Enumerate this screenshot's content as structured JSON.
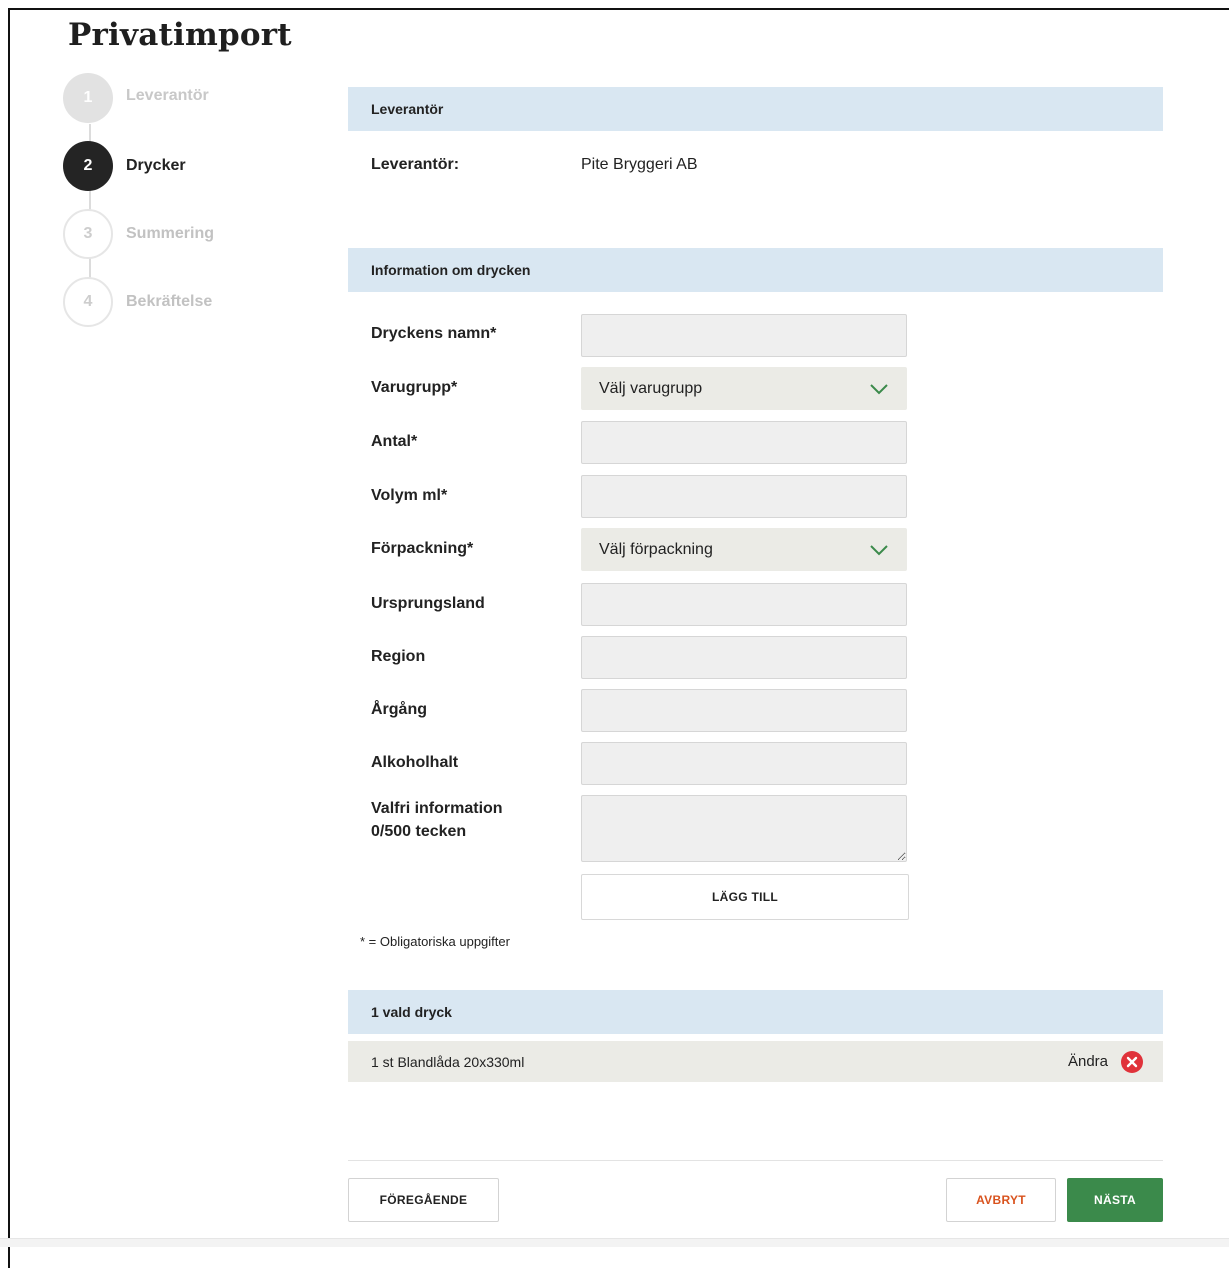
{
  "page": {
    "title": "Privatimport"
  },
  "steps": [
    {
      "number": "1",
      "label": "Leverantör",
      "state": "done"
    },
    {
      "number": "2",
      "label": "Drycker",
      "state": "active"
    },
    {
      "number": "3",
      "label": "Summering",
      "state": "future"
    },
    {
      "number": "4",
      "label": "Bekräftelse",
      "state": "future"
    }
  ],
  "supplier": {
    "header": "Leverantör",
    "label": "Leverantör:",
    "value": "Pite Bryggeri AB"
  },
  "drink_info": {
    "header": "Information om drycken",
    "name_label": "Dryckens namn*",
    "name_value": "",
    "category_label": "Varugrupp*",
    "category_selected": "Välj varugrupp",
    "quantity_label": "Antal*",
    "quantity_value": "",
    "volume_label": "Volym ml*",
    "volume_value": "",
    "packaging_label": "Förpackning*",
    "packaging_selected": "Välj förpackning",
    "origin_label": "Ursprungsland",
    "origin_value": "",
    "region_label": "Region",
    "region_value": "",
    "vintage_label": "Årgång",
    "vintage_value": "",
    "abv_label": "Alkoholhalt",
    "abv_value": "",
    "extra_label_line1": "Valfri information",
    "extra_label_line2": "0/500 tecken",
    "extra_value": "",
    "add_button": "LÄGG TILL",
    "required_note": "* = Obligatoriska uppgifter"
  },
  "selected": {
    "header": "1 vald dryck",
    "items": [
      {
        "text": "1 st Blandlåda 20x330ml",
        "edit_label": "Ändra"
      }
    ]
  },
  "footer": {
    "prev_button": "FÖREGÅENDE",
    "cancel_button": "AVBRYT",
    "next_button": "NÄSTA"
  },
  "colors": {
    "section_header_bg": "#d9e7f2",
    "next_button_bg": "#3b8a4b",
    "cancel_text": "#d9531e",
    "remove_icon": "#e0323a",
    "chevron": "#3b8a4b"
  },
  "icons": [
    "chevron-down-icon",
    "remove-icon"
  ]
}
